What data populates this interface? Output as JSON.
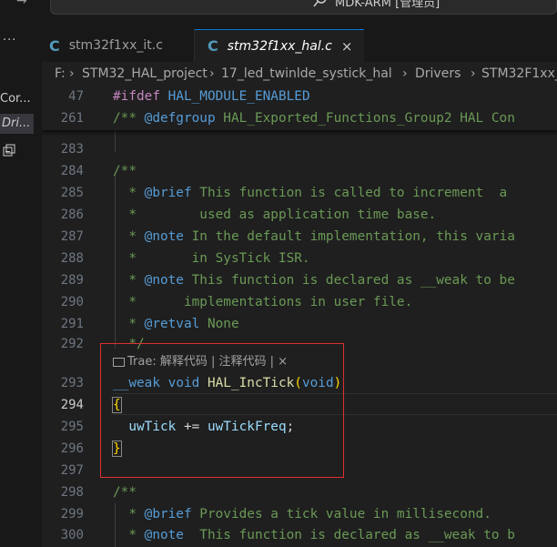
{
  "titlebar": {
    "back_icon": "arrow-right-icon",
    "command_center_text": "MDK-ARM [管理员]",
    "search_icon": "search-icon"
  },
  "sidebar": {
    "more_label": "···",
    "items": [
      {
        "label": "Cor..."
      },
      {
        "label": "Dri..."
      }
    ]
  },
  "tabs": [
    {
      "label": "stm32f1xx_it.c",
      "icon": "c-file-icon",
      "active": false
    },
    {
      "label": "stm32f1xx_hal.c",
      "icon": "c-file-icon",
      "active": true,
      "close": "×"
    }
  ],
  "breadcrumb": [
    "F:",
    "STM32_HAL_project",
    "17_led_twinlde_systick_hal",
    "Drivers",
    "STM32F1xx_"
  ],
  "breadcrumb_separator": "›",
  "sticky": [
    {
      "n": "47",
      "text": "#ifdef HAL_MODULE_ENABLED"
    },
    {
      "n": "261",
      "text": "/** @defgroup HAL_Exported_Functions_Group2 HAL Con"
    }
  ],
  "lines": [
    {
      "n": "283",
      "text": ""
    },
    {
      "n": "284",
      "text": "/**"
    },
    {
      "n": "285",
      "text": "  * @brief This function is called to increment  a"
    },
    {
      "n": "286",
      "text": "  *        used as application time base."
    },
    {
      "n": "287",
      "text": "  * @note In the default implementation, this varia"
    },
    {
      "n": "288",
      "text": "  *       in SysTick ISR."
    },
    {
      "n": "289",
      "text": "  * @note This function is declared as __weak to be"
    },
    {
      "n": "290",
      "text": "  *      implementations in user file."
    },
    {
      "n": "291",
      "text": "  * @retval None"
    },
    {
      "n": "292",
      "text": "  */"
    },
    {
      "n": "293",
      "text": "__weak void HAL_IncTick(void)"
    },
    {
      "n": "294",
      "text": "{"
    },
    {
      "n": "295",
      "text": "  uwTick += uwTickFreq;"
    },
    {
      "n": "296",
      "text": "}"
    },
    {
      "n": "297",
      "text": ""
    },
    {
      "n": "298",
      "text": "/**"
    },
    {
      "n": "299",
      "text": "  * @brief Provides a tick value in millisecond."
    },
    {
      "n": "300",
      "text": "  * @note  This function is declared as __weak to b"
    }
  ],
  "codelens": "Trae: 解释代码 | 注释代码 | ×",
  "colors": {
    "keyword": "#569cd6",
    "comment": "#6a9955",
    "function": "#dcdcaa",
    "variable": "#9cdcfe",
    "bracket": "#ffd700",
    "highlight_box": "#e0302f"
  }
}
